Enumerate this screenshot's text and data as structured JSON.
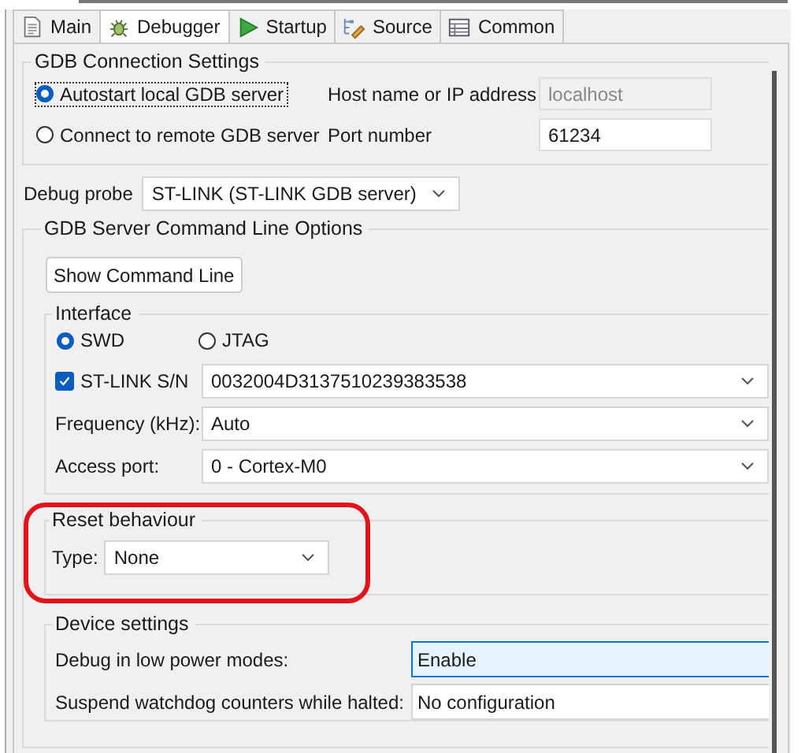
{
  "tabs": [
    {
      "label": "Main",
      "kind": "document",
      "selected": false
    },
    {
      "label": "Debugger",
      "kind": "bug",
      "selected": true
    },
    {
      "label": "Startup",
      "kind": "play",
      "selected": false
    },
    {
      "label": "Source",
      "kind": "source",
      "selected": false
    },
    {
      "label": "Common",
      "kind": "table",
      "selected": false
    }
  ],
  "gdb_connection": {
    "title": "GDB Connection Settings",
    "options": [
      {
        "label": "Autostart local GDB server",
        "selected": true
      },
      {
        "label": "Connect to remote GDB server",
        "selected": false
      }
    ],
    "host": {
      "label": "Host name or IP address",
      "value": "localhost",
      "disabled": true
    },
    "port": {
      "label": "Port number",
      "value": "61234",
      "disabled": false
    }
  },
  "debug_probe": {
    "label": "Debug probe",
    "value": "ST-LINK (ST-LINK GDB server)"
  },
  "command_line": {
    "title": "GDB Server Command Line Options",
    "button": "Show Command Line",
    "interface": {
      "title": "Interface",
      "options": [
        {
          "label": "SWD",
          "selected": true
        },
        {
          "label": "JTAG",
          "selected": false
        }
      ],
      "serial": {
        "label": "ST-LINK S/N",
        "checked": true,
        "value": "0032004D3137510239383538"
      },
      "frequency": {
        "label": "Frequency (kHz):",
        "value": "Auto"
      },
      "access_port": {
        "label": "Access port:",
        "value": "0 - Cortex-M0"
      }
    },
    "reset": {
      "title": "Reset behaviour",
      "highlighted": true,
      "type": {
        "label": "Type:",
        "value": "None"
      }
    },
    "device": {
      "title": "Device settings",
      "rows": [
        {
          "label": "Debug in low power modes:",
          "value": "Enable",
          "focused": true
        },
        {
          "label": "Suspend watchdog counters while halted:",
          "value": "No configuration",
          "focused": false
        }
      ]
    }
  }
}
